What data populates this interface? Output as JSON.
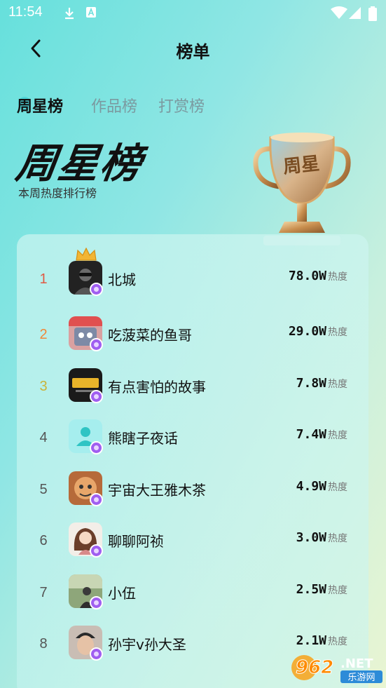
{
  "status_bar": {
    "time": "11:54"
  },
  "header": {
    "title": "榜单"
  },
  "tabs": [
    {
      "label": "周星榜",
      "active": true
    },
    {
      "label": "作品榜",
      "active": false
    },
    {
      "label": "打赏榜",
      "active": false
    }
  ],
  "hero": {
    "title": "周星榜",
    "subtitle": "本周热度排行榜",
    "trophy_text": "周星"
  },
  "colors": {
    "rank1": "#e05a44",
    "rank2": "#f0883a",
    "rank3": "#c9b33b",
    "badge": "#a05ef0"
  },
  "ranking": [
    {
      "rank": "1",
      "name": "北城",
      "heat": "78.0W",
      "unit": "热度"
    },
    {
      "rank": "2",
      "name": "吃菠菜的鱼哥",
      "heat": "29.0W",
      "unit": "热度"
    },
    {
      "rank": "3",
      "name": "有点害怕的故事",
      "heat": "7.8W",
      "unit": "热度"
    },
    {
      "rank": "4",
      "name": "熊瞎子夜话",
      "heat": "7.4W",
      "unit": "热度"
    },
    {
      "rank": "5",
      "name": "宇宙大王雅木茶",
      "heat": "4.9W",
      "unit": "热度"
    },
    {
      "rank": "6",
      "name": "聊聊阿祯",
      "heat": "3.0W",
      "unit": "热度"
    },
    {
      "rank": "7",
      "name": "小伍",
      "heat": "2.5W",
      "unit": "热度"
    },
    {
      "rank": "8",
      "name": "孙宇v孙大圣",
      "heat": "2.1W",
      "unit": "热度"
    }
  ],
  "watermark": {
    "number": "962",
    "suffix": ".NET",
    "label": "乐游网"
  }
}
